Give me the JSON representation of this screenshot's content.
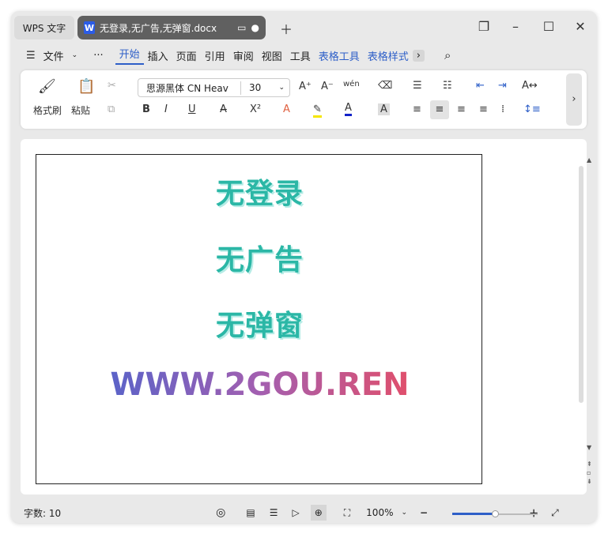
{
  "app": {
    "name": "WPS 文字",
    "doc_tab": "无登录,无广告,无弹窗.docx",
    "doc_icon": "W"
  },
  "menu": {
    "file": "文件",
    "more": "···",
    "tabs": [
      "开始",
      "插入",
      "页面",
      "引用",
      "审阅",
      "视图",
      "工具"
    ],
    "context_tabs": [
      "表格工具",
      "表格样式"
    ]
  },
  "ribbon": {
    "format_painter": "格式刷",
    "paste": "粘贴",
    "font_name": "思源黑体 CN Heav",
    "font_size": "30",
    "bold": "B",
    "italic": "I",
    "underline": "U",
    "superscript": "X²",
    "text_effect": "A",
    "font_color": "A",
    "char_shade": "A",
    "grow": "A⁺",
    "shrink": "A⁻",
    "pinyin": "wén"
  },
  "document": {
    "lines": [
      "无登录",
      "无广告",
      "无弹窗"
    ],
    "url": "WWW.2GOU.REN"
  },
  "status": {
    "word_count": "字数: 10",
    "zoom": "100%",
    "zoom_level": 100
  },
  "colors": {
    "accent": "#2e5fc8",
    "teal_text": "#2bb7a6",
    "gradient_start": "#5b63c8",
    "gradient_end": "#e04f6c"
  }
}
